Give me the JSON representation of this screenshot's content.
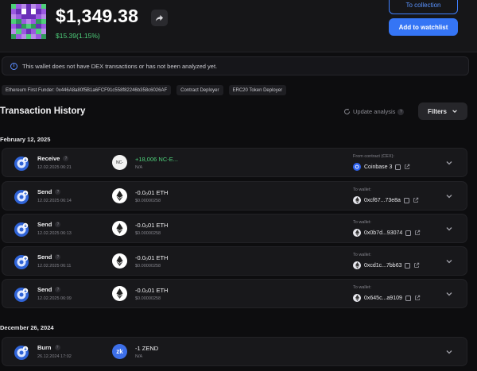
{
  "wallet": {
    "balance": "$1,349.38",
    "change": "$15.39(1.15%)",
    "to_collection_label": "To collection",
    "add_watchlist_label": "Add to watchlist"
  },
  "notice": {
    "text": "This wallet does not have DEX transactions or has not been analyzed yet."
  },
  "tags": [
    "Ethereum First Funder: 0x446A8a80f5B1a6FCF91c558f82246b358c6026AF",
    "Contract Deployer",
    "ERC20 Token Deployer"
  ],
  "history": {
    "title": "Transaction History",
    "update_label": "Update analysis",
    "filters_label": "Filters",
    "help_glyph": "?"
  },
  "groups": [
    {
      "date": "February 12, 2025",
      "transactions": [
        {
          "type": "Receive",
          "time": "12.02.2025 06:21",
          "token_label": "NC-",
          "amount": "+18,006 NC-E...",
          "usd": "N/A",
          "cp_label": "From contract (CEX):",
          "cp_value": "Coinbase 3"
        },
        {
          "type": "Send",
          "time": "12.02.2025 06:14",
          "token_label": "",
          "amount": "-0.0₀01 ETH",
          "usd": "$0.00000258",
          "cp_label": "To wallet:",
          "cp_value": "0xcf67...73e8a"
        },
        {
          "type": "Send",
          "time": "12.02.2025 06:13",
          "token_label": "",
          "amount": "-0.0₀01 ETH",
          "usd": "$0.00000258",
          "cp_label": "To wallet:",
          "cp_value": "0x0b7d...93074"
        },
        {
          "type": "Send",
          "time": "12.02.2025 06:11",
          "token_label": "",
          "amount": "-0.0₀01 ETH",
          "usd": "$0.00000258",
          "cp_label": "To wallet:",
          "cp_value": "0xcd1c...7bb63"
        },
        {
          "type": "Send",
          "time": "12.02.2025 06:09",
          "token_label": "",
          "amount": "-0.0₀01 ETH",
          "usd": "$0.00000258",
          "cp_label": "To wallet:",
          "cp_value": "0x645c...a9109"
        }
      ]
    },
    {
      "date": "December 26, 2024",
      "transactions": [
        {
          "type": "Burn",
          "time": "26.12.2024 17:02",
          "token_label": "zk",
          "amount": "-1 ZEND",
          "usd": "N/A",
          "cp_label": "",
          "cp_value": ""
        }
      ]
    }
  ],
  "icons": {
    "share": "share-arrow-icon",
    "info": "info-icon",
    "refresh": "refresh-icon",
    "chevron": "chevron-down-icon",
    "eth": "ethereum-icon",
    "copy": "copy-icon",
    "external": "external-link-icon",
    "coinbase": "coinbase-icon"
  },
  "colors": {
    "accent": "#3575f5",
    "positive": "#4ed07a",
    "background": "#0d0d0f",
    "card": "#18181b"
  }
}
